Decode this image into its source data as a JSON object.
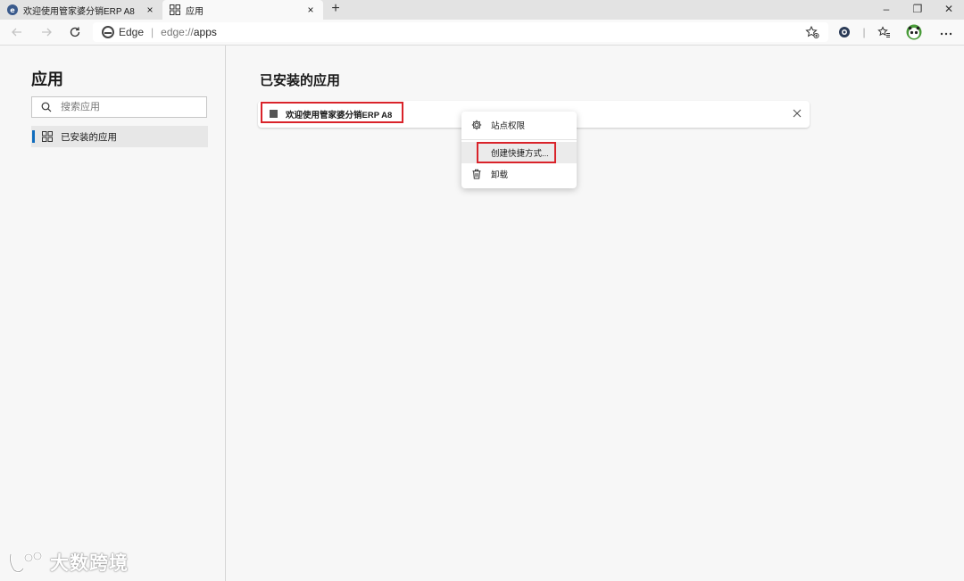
{
  "tabs": [
    {
      "title": "欢迎使用管家婆分销ERP A8",
      "icon": "erp-site-icon",
      "active": false
    },
    {
      "title": "应用",
      "icon": "apps-icon",
      "active": true
    }
  ],
  "tab_close_glyph": "×",
  "new_tab_glyph": "+",
  "window_controls": {
    "minimize": "–",
    "restore": "❐",
    "close": "✕"
  },
  "address": {
    "site_label": "Edge",
    "separator": "|",
    "scheme": "edge://",
    "path": "apps"
  },
  "sidebar": {
    "title": "应用",
    "search_placeholder": "搜索应用",
    "items": [
      {
        "label": "已安装的应用",
        "selected": true
      }
    ]
  },
  "main": {
    "title": "已安装的应用",
    "apps": [
      {
        "name": "欢迎使用管家婆分销ERP A8"
      }
    ]
  },
  "context_menu": {
    "items": [
      {
        "label": "站点权限",
        "icon": "gear-icon"
      },
      {
        "label": "创建快捷方式...",
        "icon": "",
        "highlighted": true
      },
      {
        "label": "卸载",
        "icon": "trash-icon"
      }
    ]
  },
  "watermark": {
    "text": "大数跨境"
  },
  "colors": {
    "accent": "#0f6cbd",
    "highlight_box": "#d9232a"
  }
}
